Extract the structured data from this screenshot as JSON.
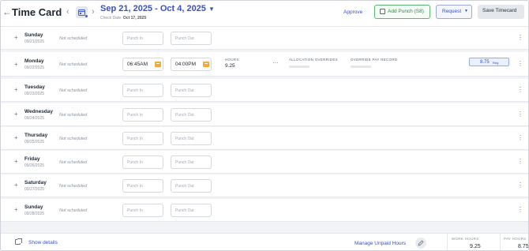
{
  "header": {
    "title": "Time Card",
    "date_range": "Sep 21, 2025 - Oct 4, 2025",
    "check_date_label": "Check Date:",
    "check_date_value": "Oct 17, 2025",
    "approve_label": "Approve",
    "add_punch_label": "Add Punch (S8)",
    "request_label": "Request",
    "save_label": "Save Timecard"
  },
  "placeholders": {
    "punch_in": "Punch In",
    "punch_out": "Punch Out"
  },
  "rows": [
    {
      "day": "Sunday",
      "date": "09/21/2025",
      "status": "Not scheduled"
    },
    {
      "day": "Monday",
      "date": "09/22/2025",
      "status": "Not scheduled",
      "punch_in": "06:45AM",
      "punch_out": "04:00PM",
      "hours_label": "HOURS",
      "hours_value": "9.25",
      "allocation_label": "ALLOCATION OVERRIDES",
      "override_label": "OVERRIDE PAY RECORD",
      "pay_value": "8.75",
      "pay_type": "Reg"
    },
    {
      "day": "Tuesday",
      "date": "09/23/2025",
      "status": "Not scheduled"
    },
    {
      "day": "Wednesday",
      "date": "09/24/2025",
      "status": "Not scheduled"
    },
    {
      "day": "Thursday",
      "date": "09/25/2025",
      "status": "Not scheduled"
    },
    {
      "day": "Friday",
      "date": "09/26/2025",
      "status": "Not scheduled"
    },
    {
      "day": "Saturday",
      "date": "09/27/2025",
      "status": "Not scheduled"
    },
    {
      "day": "Sunday",
      "date": "09/28/2025",
      "status": "Not scheduled"
    }
  ],
  "footer": {
    "show_details": "Show details",
    "manage_unpaid": "Manage Unpaid Hours",
    "work_hours_label": "WORK HOURS",
    "work_hours_value": "9.25",
    "pay_hours_label": "PAY HOURS",
    "pay_hours_value": "8.75"
  },
  "colors": {
    "accent": "#3552c8",
    "success": "#2e8a46",
    "warning": "#f3a93b"
  },
  "icons": [
    "back-arrow-icon",
    "chevron-left-icon",
    "calendar-icon",
    "chevron-right-icon",
    "caret-down-icon",
    "plus-icon",
    "clock-icon",
    "kebab-menu-icon",
    "external-link-icon",
    "pencil-icon"
  ]
}
